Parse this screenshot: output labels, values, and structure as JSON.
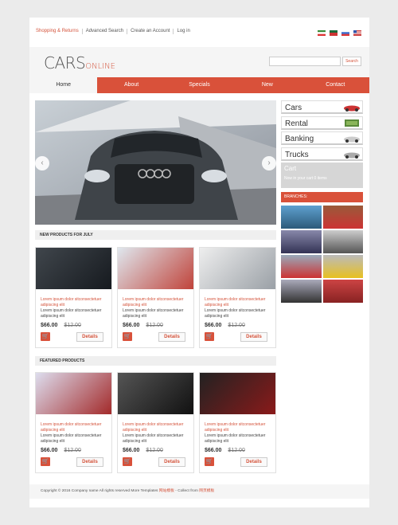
{
  "topbar": [
    "Shopping & Returns",
    "Advanced Search",
    "Create an Account",
    "Log in"
  ],
  "logo": {
    "main": "CARS",
    "sub": "ONLINE"
  },
  "search_button": "Search",
  "nav": [
    "Home",
    "About",
    "Specials",
    "New",
    "Contact"
  ],
  "categories": [
    "Cars",
    "Rental",
    "Banking",
    "Trucks"
  ],
  "cart": {
    "title": "Cart",
    "status": "Now in your cart 0 items"
  },
  "branches_label": "BRANCHES:",
  "sections": {
    "new": "NEW PRODUCTS FOR JULY",
    "featured": "FEATURED PRODUCTS"
  },
  "product": {
    "title": "Lorem ipsum dolor sitconsectetuer adipiscing elit",
    "desc": "Lorem ipsum dolor sitconsectetuer adipiscing elit",
    "price": "$66.00",
    "old": "$12.00",
    "details": "Details"
  },
  "footer": {
    "text": "Copyright © 2016 Company name All rights reserved More Templates ",
    "link1": "网站模板",
    "mid": " - Collect from ",
    "link2": "网页模板"
  },
  "colors": {
    "accent": "#d9513a"
  }
}
